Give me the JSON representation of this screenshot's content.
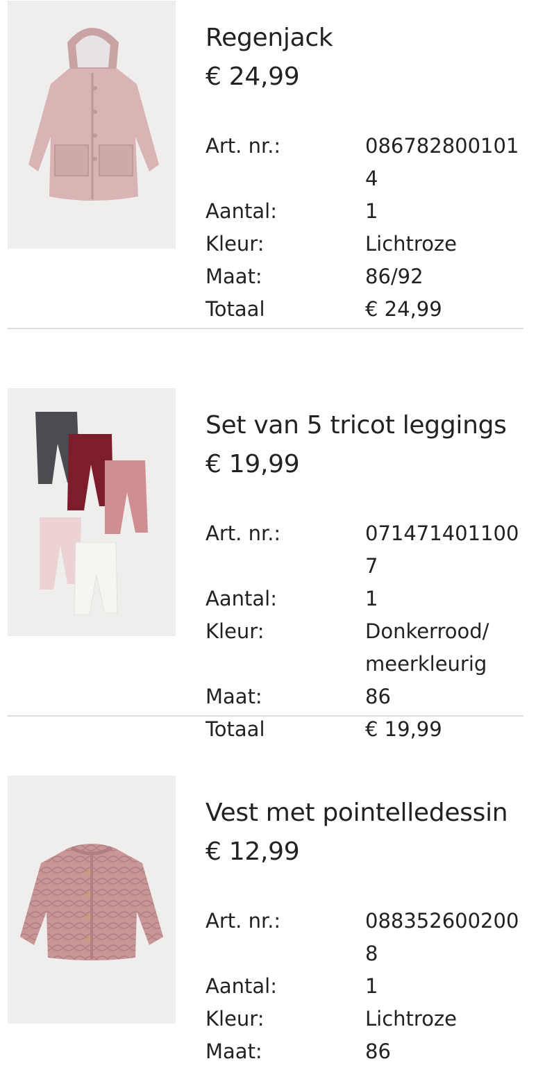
{
  "items": [
    {
      "title": "Regenjack",
      "price": "€ 24,99",
      "article_label": "Art. nr.:",
      "article_value": "0867828001014",
      "quantity_label": "Aantal:",
      "quantity_value": "1",
      "color_label": "Kleur:",
      "color_value": "Lichtroze",
      "size_label": "Maat:",
      "size_value": "86/92",
      "total_label": "Totaal",
      "total_value": "€ 24,99",
      "image_icon": "pink-raincoat-image"
    },
    {
      "title": "Set van 5 tricot leggings",
      "price": "€ 19,99",
      "article_label": "Art. nr.:",
      "article_value": "0714714011007",
      "quantity_label": "Aantal:",
      "quantity_value": "1",
      "color_label": "Kleur:",
      "color_value": "Donkerrood/ meerkleurig",
      "size_label": "Maat:",
      "size_value": "86",
      "total_label": "Totaal",
      "total_value": "€ 19,99",
      "image_icon": "leggings-set-image"
    },
    {
      "title": "Vest met pointelledessin",
      "price": "€ 12,99",
      "article_label": "Art. nr.:",
      "article_value": "0883526002008",
      "quantity_label": "Aantal:",
      "quantity_value": "1",
      "color_label": "Kleur:",
      "color_value": "Lichtroze",
      "size_label": "Maat:",
      "size_value": "86",
      "image_icon": "pink-cardigan-image"
    }
  ],
  "colors": {
    "text": "#222222",
    "divider": "#dcdcdc",
    "image_background": "#efeeec"
  }
}
